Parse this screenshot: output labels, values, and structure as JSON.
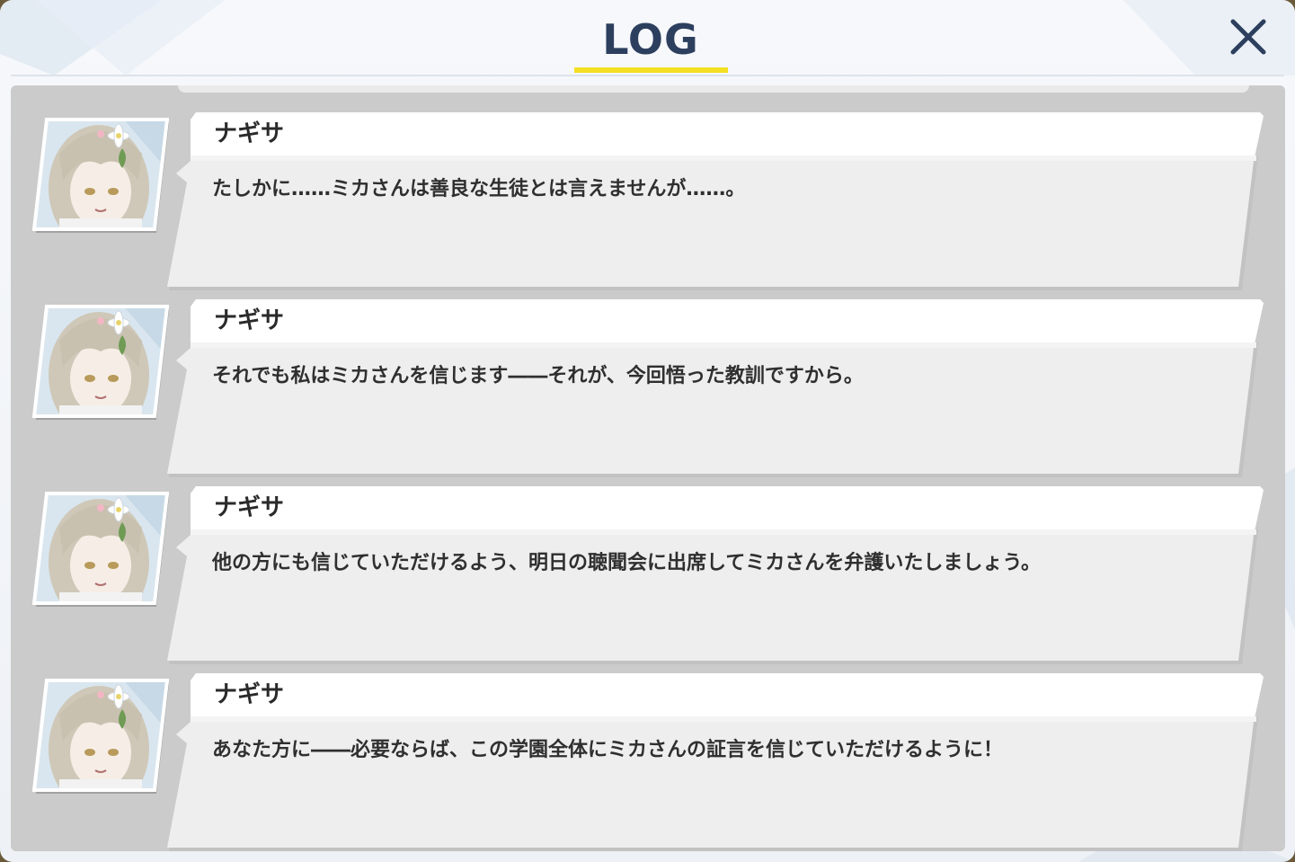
{
  "header": {
    "title": "LOG",
    "accent_color": "#f4df22",
    "title_color": "#2d3f5e",
    "close_icon": "close-icon"
  },
  "log": {
    "entries": [
      {
        "speaker": "ナギサ",
        "avatar": "character-portrait",
        "message": "たしかに……ミカさんは善良な生徒とは言えませんが……。"
      },
      {
        "speaker": "ナギサ",
        "avatar": "character-portrait",
        "message": "それでも私はミカさんを信じます――それが、今回悟った教訓ですから。"
      },
      {
        "speaker": "ナギサ",
        "avatar": "character-portrait",
        "message": "他の方にも信じていただけるよう、明日の聴聞会に出席してミカさんを弁護いたしましょう。"
      },
      {
        "speaker": "ナギサ",
        "avatar": "character-portrait",
        "message": "あなた方に――必要ならば、この学園全体にミカさんの証言を信じていただけるように！"
      }
    ]
  }
}
